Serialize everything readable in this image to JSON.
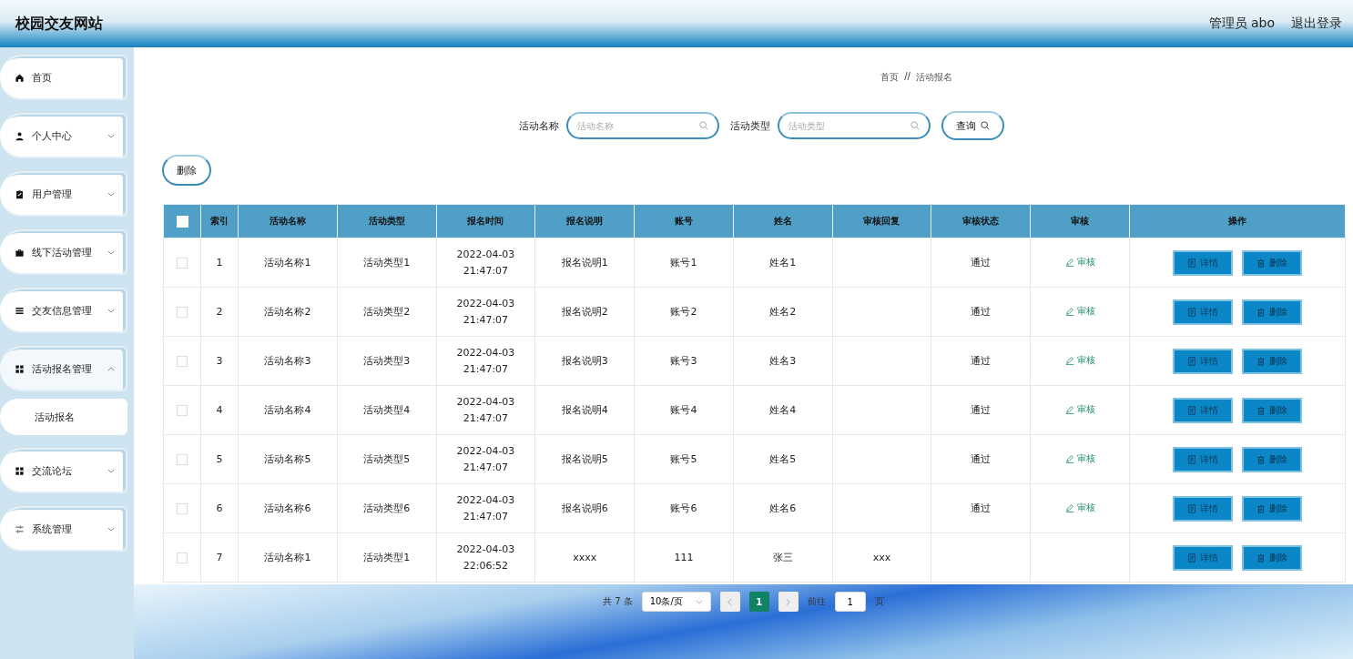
{
  "header": {
    "title": "校园交友网站",
    "user": "管理员 abo",
    "logout": "退出登录"
  },
  "sidebar": {
    "items": [
      {
        "label": "首页"
      },
      {
        "label": "个人中心",
        "expanded": false
      },
      {
        "label": "用户管理",
        "expanded": false
      },
      {
        "label": "线下活动管理",
        "expanded": false
      },
      {
        "label": "交友信息管理",
        "expanded": false
      },
      {
        "label": "活动报名管理",
        "expanded": true,
        "children": [
          {
            "label": "活动报名",
            "selected": true
          }
        ]
      },
      {
        "label": "交流论坛",
        "expanded": false
      },
      {
        "label": "系统管理",
        "expanded": false
      }
    ]
  },
  "breadcrumb": {
    "items": [
      "首页",
      "活动报名"
    ],
    "separator": "//"
  },
  "search": {
    "fields": [
      {
        "label": "活动名称",
        "placeholder": "活动名称"
      },
      {
        "label": "活动类型",
        "placeholder": "活动类型"
      }
    ],
    "button": "查询"
  },
  "delete_button": "删除",
  "table": {
    "header_checked": false,
    "columns": [
      "索引",
      "活动名称",
      "活动类型",
      "报名时间",
      "报名说明",
      "账号",
      "姓名",
      "审核回复",
      "审核状态",
      "审核",
      "操作"
    ],
    "rows": [
      {
        "checked": false,
        "cells": [
          "1",
          "活动名称1",
          "活动类型1",
          "2022-04-03 21:47:07",
          "报名说明1",
          "账号1",
          "姓名1",
          "",
          "通过"
        ],
        "review": "审核",
        "actions": [
          "详情",
          "删除"
        ]
      },
      {
        "checked": false,
        "cells": [
          "2",
          "活动名称2",
          "活动类型2",
          "2022-04-03 21:47:07",
          "报名说明2",
          "账号2",
          "姓名2",
          "",
          "通过"
        ],
        "review": "审核",
        "actions": [
          "详情",
          "删除"
        ]
      },
      {
        "checked": false,
        "cells": [
          "3",
          "活动名称3",
          "活动类型3",
          "2022-04-03 21:47:07",
          "报名说明3",
          "账号3",
          "姓名3",
          "",
          "通过"
        ],
        "review": "审核",
        "actions": [
          "详情",
          "删除"
        ]
      },
      {
        "checked": false,
        "cells": [
          "4",
          "活动名称4",
          "活动类型4",
          "2022-04-03 21:47:07",
          "报名说明4",
          "账号4",
          "姓名4",
          "",
          "通过"
        ],
        "review": "审核",
        "actions": [
          "详情",
          "删除"
        ]
      },
      {
        "checked": false,
        "cells": [
          "5",
          "活动名称5",
          "活动类型5",
          "2022-04-03 21:47:07",
          "报名说明5",
          "账号5",
          "姓名5",
          "",
          "通过"
        ],
        "review": "审核",
        "actions": [
          "详情",
          "删除"
        ]
      },
      {
        "checked": false,
        "cells": [
          "6",
          "活动名称6",
          "活动类型6",
          "2022-04-03 21:47:07",
          "报名说明6",
          "账号6",
          "姓名6",
          "",
          "通过"
        ],
        "review": "审核",
        "actions": [
          "详情",
          "删除"
        ]
      },
      {
        "checked": false,
        "cells": [
          "7",
          "活动名称1",
          "活动类型1",
          "2022-04-03 22:06:52",
          "xxxx",
          "111",
          "张三",
          "xxx",
          ""
        ],
        "review": "",
        "actions": [
          "详情",
          "删除"
        ]
      }
    ]
  },
  "pagination": {
    "total": "共 7 条",
    "page_size": "10条/页",
    "pages": [
      {
        "label": "1",
        "selected": true
      }
    ],
    "goto_label": "前往",
    "goto_value": "1",
    "goto_unit": "页"
  }
}
